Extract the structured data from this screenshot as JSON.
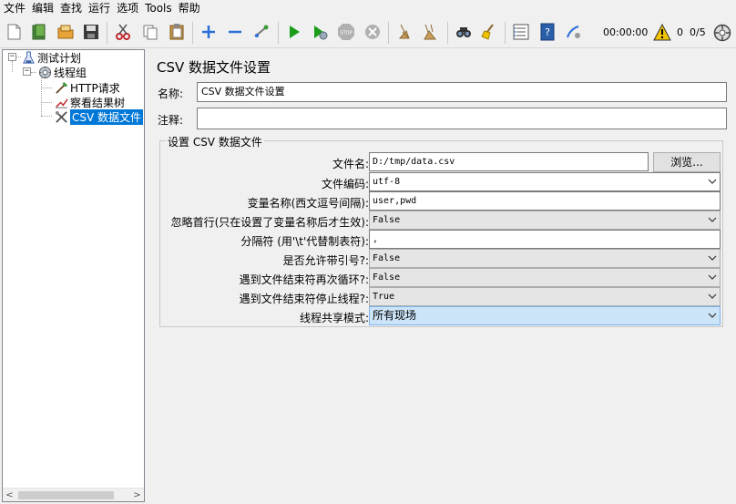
{
  "menu": [
    "文件",
    "编辑",
    "查找",
    "运行",
    "选项",
    "Tools",
    "帮助"
  ],
  "toolbar": {
    "icons": [
      "new-icon",
      "templates-icon",
      "open-icon",
      "save-icon",
      "cut-icon",
      "copy-icon",
      "paste-icon",
      "expand-icon",
      "collapse-icon",
      "toggle-icon",
      "start-icon",
      "start-no-pause-icon",
      "stop-icon",
      "shutdown-icon",
      "clear-icon",
      "clear-all-icon",
      "search-icon",
      "reset-search-icon",
      "function-helper-icon",
      "help-icon",
      "remote-icon"
    ],
    "timer": "00:00:00",
    "warning_count": "0",
    "threads": "0/5"
  },
  "tree": {
    "nodes": [
      {
        "label": "测试计划",
        "icon": "test-plan-icon"
      },
      {
        "label": "线程组",
        "icon": "thread-group-icon"
      },
      {
        "label": "HTTP请求",
        "icon": "http-request-icon"
      },
      {
        "label": "察看结果树",
        "icon": "view-results-tree-icon"
      },
      {
        "label": "CSV 数据文件",
        "icon": "csv-config-icon",
        "selected": true
      }
    ]
  },
  "panel": {
    "title": "CSV 数据文件设置",
    "name_label": "名称:",
    "name_value": "CSV 数据文件设置",
    "comment_label": "注释:",
    "comment_value": "",
    "group_title": "设置 CSV 数据文件",
    "filename_label": "文件名:",
    "filename_value": "D:/tmp/data.csv",
    "browse_label": "浏览...",
    "encoding_label": "文件编码:",
    "encoding_value": "utf-8",
    "varnames_label": "变量名称(西文逗号间隔):",
    "varnames_value": "user,pwd",
    "ignore_first_label": "忽略首行(只在设置了变量名称后才生效):",
    "ignore_first_value": "False",
    "delimiter_label": "分隔符 (用'\\t'代替制表符):",
    "delimiter_value": ",",
    "quoted_label": "是否允许带引号?:",
    "quoted_value": "False",
    "recycle_label": "遇到文件结束符再次循环?:",
    "recycle_value": "False",
    "stop_thread_label": "遇到文件结束符停止线程?:",
    "stop_thread_value": "True",
    "sharing_label": "线程共享模式:",
    "sharing_value": "所有现场"
  },
  "colors": {
    "selection": "#0078d7",
    "highlight_combo": "#cce4f7",
    "run_green": "#1a9e1a"
  }
}
